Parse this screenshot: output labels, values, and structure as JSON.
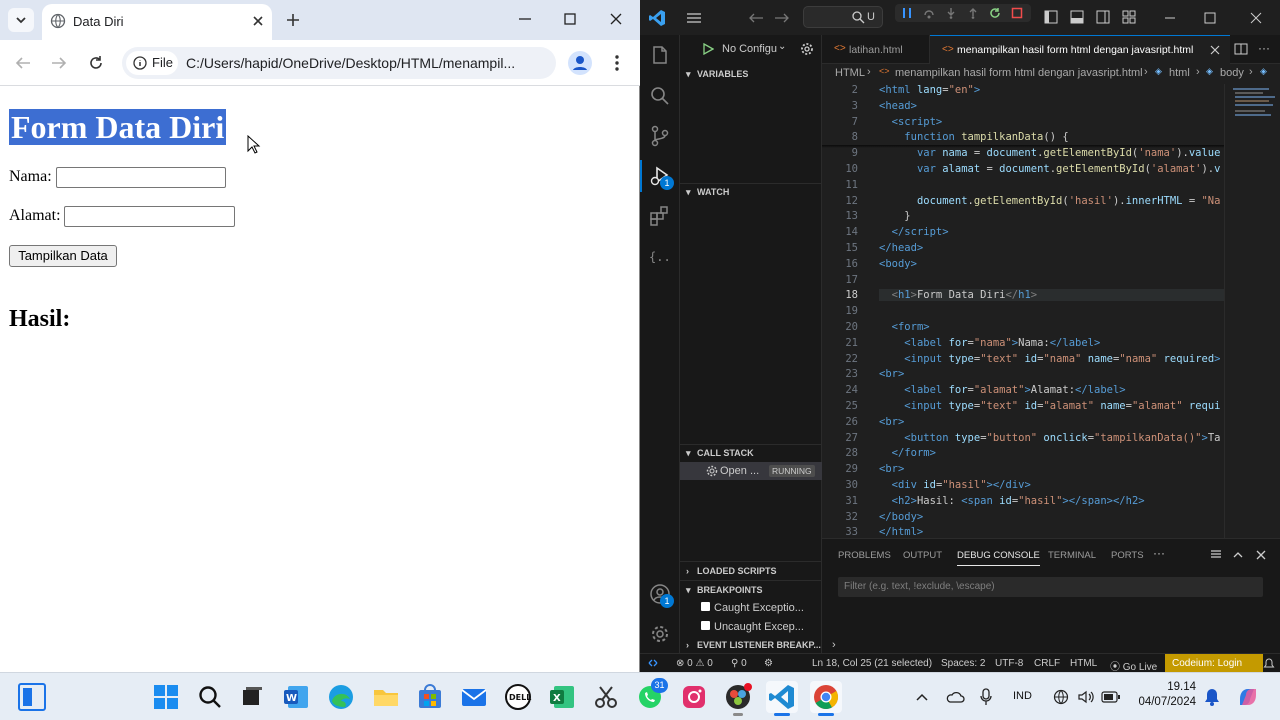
{
  "browser": {
    "tab_title": "Data Diri",
    "file_chip": "File",
    "url": "C:/Users/hapid/OneDrive/Desktop/HTML/menampil..."
  },
  "page": {
    "heading": "Form Data Diri",
    "nama_label": "Nama:",
    "alamat_label": "Alamat:",
    "button_label": "Tampilkan Data",
    "hasil_label": "Hasil:"
  },
  "vscode": {
    "search_text": "U",
    "run_config": "No Configu",
    "tabs": [
      "latihan.html",
      "menampilkan hasil form html dengan javasript.html"
    ],
    "breadcrumb": [
      "HTML",
      "menampilkan hasil form html dengan javasript.html",
      "html",
      "body"
    ],
    "sidebar": {
      "variables": "VARIABLES",
      "watch": "WATCH",
      "call_stack": "CALL STACK",
      "call_item": "Open ...",
      "call_status": "RUNNING",
      "loaded_scripts": "LOADED SCRIPTS",
      "breakpoints": "BREAKPOINTS",
      "bp_caught": "Caught Exceptio...",
      "bp_uncaught": "Uncaught Excep...",
      "event_listener": "EVENT LISTENER BREAKP..."
    },
    "badges": {
      "debug": "1",
      "accounts": "1"
    },
    "code_lines": [
      {
        "n": "2",
        "html": "<span class='t'>&lt;html</span> <span class='a'>lang</span>=<span class='s'>\"en\"</span><span class='t'>&gt;</span>"
      },
      {
        "n": "3",
        "html": "<span class='t'>&lt;head&gt;</span>"
      },
      {
        "n": "7",
        "html": "  <span class='t'>&lt;script&gt;</span>"
      },
      {
        "n": "8",
        "html": "    <span class='k'>function</span> <span class='f'>tampilkanData</span>() {"
      },
      {
        "n": "9",
        "html": "      <span class='k'>var</span> <span class='a'>nama</span> = <span class='a'>document</span>.<span class='f'>getElementById</span>(<span class='s'>'nama'</span>).<span class='a'>value</span>"
      },
      {
        "n": "10",
        "html": "      <span class='k'>var</span> <span class='a'>alamat</span> = <span class='a'>document</span>.<span class='f'>getElementById</span>(<span class='s'>'alamat'</span>).<span class='a'>v</span>"
      },
      {
        "n": "11",
        "html": ""
      },
      {
        "n": "12",
        "html": "      <span class='a'>document</span>.<span class='f'>getElementById</span>(<span class='s'>'hasil'</span>).<span class='a'>innerHTML</span> = <span class='s'>\"Na</span>"
      },
      {
        "n": "13",
        "html": "    }"
      },
      {
        "n": "14",
        "html": "  <span class='t'>&lt;/script&gt;</span>"
      },
      {
        "n": "15",
        "html": "<span class='t'>&lt;/head&gt;</span>"
      },
      {
        "n": "16",
        "html": "<span class='t'>&lt;body&gt;</span>"
      },
      {
        "n": "17",
        "html": ""
      },
      {
        "n": "18",
        "html": "  <span class='g'>&lt;</span><span class='t'>h1</span><span class='g'>&gt;</span>Form Data Diri<span class='g'>&lt;/</span><span class='t'>h1</span><span class='g'>&gt;</span>"
      },
      {
        "n": "19",
        "html": ""
      },
      {
        "n": "20",
        "html": "  <span class='t'>&lt;form&gt;</span>"
      },
      {
        "n": "21",
        "html": "    <span class='t'>&lt;label</span> <span class='a'>for</span>=<span class='s'>\"nama\"</span><span class='t'>&gt;</span>Nama:<span class='t'>&lt;/label&gt;</span>"
      },
      {
        "n": "22",
        "html": "    <span class='t'>&lt;input</span> <span class='a'>type</span>=<span class='s'>\"text\"</span> <span class='a'>id</span>=<span class='s'>\"nama\"</span> <span class='a'>name</span>=<span class='s'>\"nama\"</span> <span class='a'>required</span><span class='t'>&gt;</span>"
      },
      {
        "n": "23",
        "html": "<span class='t'>&lt;br&gt;</span>"
      },
      {
        "n": "24",
        "html": "    <span class='t'>&lt;label</span> <span class='a'>for</span>=<span class='s'>\"alamat\"</span><span class='t'>&gt;</span>Alamat:<span class='t'>&lt;/label&gt;</span>"
      },
      {
        "n": "25",
        "html": "    <span class='t'>&lt;input</span> <span class='a'>type</span>=<span class='s'>\"text\"</span> <span class='a'>id</span>=<span class='s'>\"alamat\"</span> <span class='a'>name</span>=<span class='s'>\"alamat\"</span> <span class='a'>requi</span>"
      },
      {
        "n": "26",
        "html": "<span class='t'>&lt;br&gt;</span>"
      },
      {
        "n": "27",
        "html": "    <span class='t'>&lt;button</span> <span class='a'>type</span>=<span class='s'>\"button\"</span> <span class='a'>onclick</span>=<span class='s'>\"tampilkanData()\"</span><span class='t'>&gt;</span>Ta"
      },
      {
        "n": "28",
        "html": "  <span class='t'>&lt;/form&gt;</span>"
      },
      {
        "n": "29",
        "html": "<span class='t'>&lt;br&gt;</span>"
      },
      {
        "n": "30",
        "html": "  <span class='t'>&lt;div</span> <span class='a'>id</span>=<span class='s'>\"hasil\"</span><span class='t'>&gt;&lt;/div&gt;</span>"
      },
      {
        "n": "31",
        "html": "  <span class='t'>&lt;h2&gt;</span>Hasil: <span class='t'>&lt;span</span> <span class='a'>id</span>=<span class='s'>\"hasil\"</span><span class='t'>&gt;&lt;/span&gt;&lt;/h2&gt;</span>"
      },
      {
        "n": "32",
        "html": "<span class='t'>&lt;/body&gt;</span>"
      },
      {
        "n": "33",
        "html": "<span class='t'>&lt;/html&gt;</span>"
      }
    ],
    "panel_tabs": [
      "PROBLEMS",
      "OUTPUT",
      "DEBUG CONSOLE",
      "TERMINAL",
      "PORTS"
    ],
    "panel_more": "···",
    "filter_placeholder": "Filter (e.g. text, !exclude, \\escape)",
    "status": {
      "errors": "0",
      "warnings": "0",
      "ports": "0",
      "position": "Ln 18, Col 25 (21 selected)",
      "spaces": "Spaces: 2",
      "encoding": "UTF-8",
      "eol": "CRLF",
      "language": "HTML",
      "golive": "Go Live",
      "codeium": "Codeium: Login"
    }
  },
  "taskbar": {
    "whatsapp_badge": "31",
    "lang": "IND",
    "time": "19.14",
    "date": "04/07/2024"
  },
  "colors": {
    "selection": "#3d6ed2",
    "vscode_accent": "#0078d4",
    "codeium": "#c49a00"
  }
}
